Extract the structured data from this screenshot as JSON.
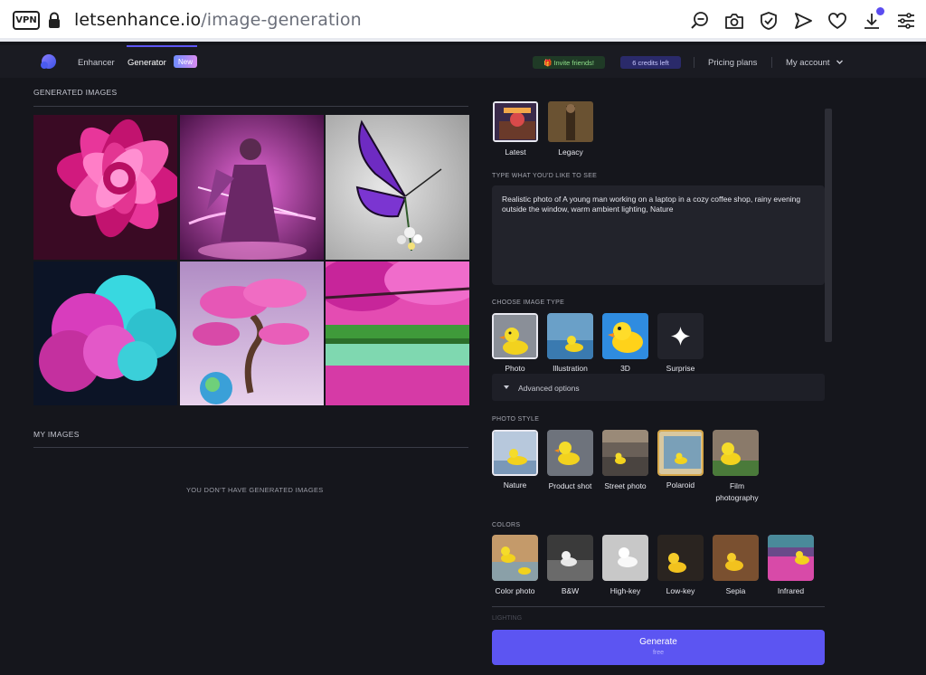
{
  "browser": {
    "vpn_label": "VPN",
    "url_host": "letsenhance.io",
    "url_path": "/image-generation"
  },
  "nav": {
    "enhancer": "Enhancer",
    "generator": "Generator",
    "new_badge": "New",
    "invite": "🎁 Invite friends!",
    "credits": "6 credits left",
    "pricing": "Pricing plans",
    "account": "My account"
  },
  "left": {
    "generated_title": "GENERATED IMAGES",
    "my_images_title": "MY IMAGES",
    "empty_message": "YOU DON'T HAVE GENERATED IMAGES",
    "images": [
      "pink-flower",
      "pink-warrior",
      "purple-butterfly",
      "pink-cyan-cloud",
      "pink-bonsai-tree",
      "pink-forest-lake"
    ]
  },
  "right": {
    "models": [
      {
        "label": "Latest",
        "selected": true
      },
      {
        "label": "Legacy",
        "selected": false
      }
    ],
    "prompt_label": "TYPE WHAT YOU'D LIKE TO SEE",
    "prompt_text": "Realistic photo of A young man working on a laptop in a cozy coffee shop, rainy evening outside the window, warm ambient lighting, Nature",
    "image_type_label": "CHOOSE IMAGE TYPE",
    "image_types": [
      "Photo",
      "Illustration",
      "3D",
      "Surprise"
    ],
    "advanced": "Advanced options",
    "photo_style_label": "PHOTO STYLE",
    "photo_styles": [
      "Nature",
      "Product shot",
      "Street photo",
      "Polaroid",
      "Film photography"
    ],
    "colors_label": "COLORS",
    "colors": [
      "Color photo",
      "B&W",
      "High-key",
      "Low-key",
      "Sepia",
      "Infrared"
    ],
    "lighting_label": "LIGHTING",
    "generate": "Generate",
    "generate_sub": "free"
  },
  "colors": {
    "accent": "#5c55f2",
    "background": "#15161c"
  }
}
